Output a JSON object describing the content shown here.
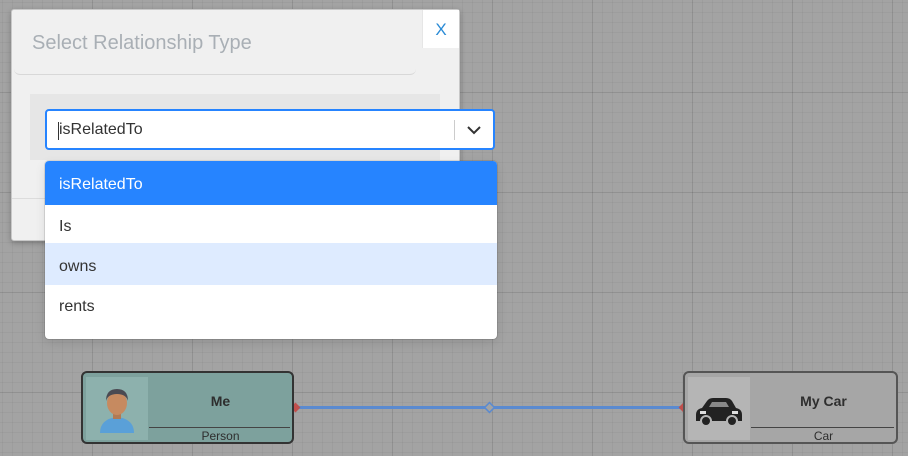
{
  "modal": {
    "title": "Select Relationship Type",
    "close_label": "X"
  },
  "select": {
    "value": "isRelatedTo",
    "options": [
      {
        "label": "isRelatedTo",
        "state": "selected"
      },
      {
        "label": "Is",
        "state": "normal"
      },
      {
        "label": "owns",
        "state": "focused"
      },
      {
        "label": "rents",
        "state": "normal"
      }
    ]
  },
  "graph": {
    "nodes": [
      {
        "name": "Me",
        "type": "Person",
        "icon": "person-avatar-icon"
      },
      {
        "name": "My Car",
        "type": "Car",
        "icon": "car-icon"
      }
    ],
    "edge_color": "#5a8ad0"
  }
}
